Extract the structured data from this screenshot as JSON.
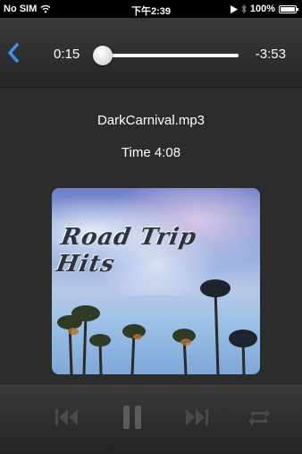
{
  "status_bar": {
    "carrier": "No SIM",
    "time": "下午2:39",
    "battery": "100%"
  },
  "player": {
    "elapsed": "0:15",
    "remaining": "-3:53",
    "progress_fraction": 0.06
  },
  "track": {
    "title": "DarkCarnival.mp3",
    "time_label": "Time 4:08"
  },
  "artwork": {
    "text": "Road Trip Hits"
  },
  "controls": {
    "icons": [
      "previous-icon",
      "pause-icon",
      "next-icon",
      "repeat-icon"
    ]
  },
  "colors": {
    "accent": "#3d8ef7",
    "background": "#2c2c2c"
  }
}
